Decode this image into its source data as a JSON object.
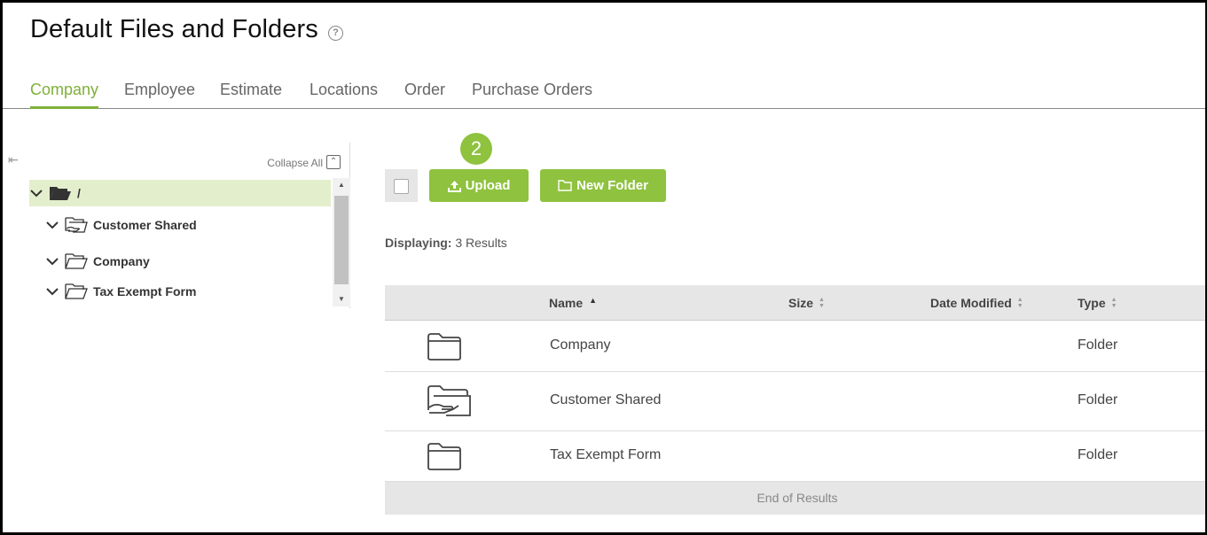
{
  "page": {
    "title": "Default Files and Folders",
    "help_icon": "question-circle-icon"
  },
  "tabs": [
    {
      "label": "Company",
      "active": true
    },
    {
      "label": "Employee",
      "active": false
    },
    {
      "label": "Estimate",
      "active": false
    },
    {
      "label": "Locations",
      "active": false
    },
    {
      "label": "Order",
      "active": false
    },
    {
      "label": "Purchase Orders",
      "active": false
    }
  ],
  "tree": {
    "collapse_all_label": "Collapse All",
    "root_label": "/",
    "items": [
      {
        "label": "Customer Shared",
        "icon": "shared-folder-icon"
      },
      {
        "label": "Company",
        "icon": "folder-icon"
      },
      {
        "label": "Tax Exempt Form",
        "icon": "folder-icon"
      }
    ]
  },
  "toolbar": {
    "step_badge": "2",
    "upload_label": "Upload",
    "new_folder_label": "New Folder"
  },
  "results": {
    "displaying_label": "Displaying:",
    "displaying_count": "3 Results",
    "end_label": "End of Results"
  },
  "grid": {
    "columns": [
      "Name",
      "Size",
      "Date Modified",
      "Type"
    ],
    "rows": [
      {
        "name": "Company",
        "size": "",
        "date_modified": "",
        "type": "Folder",
        "icon": "folder-icon"
      },
      {
        "name": "Customer Shared",
        "size": "",
        "date_modified": "",
        "type": "Folder",
        "icon": "shared-folder-icon"
      },
      {
        "name": "Tax Exempt Form",
        "size": "",
        "date_modified": "",
        "type": "Folder",
        "icon": "folder-icon"
      }
    ]
  },
  "colors": {
    "accent": "#8fc23f",
    "tab_active": "#7fb038",
    "selected_row": "#e3efcc"
  }
}
